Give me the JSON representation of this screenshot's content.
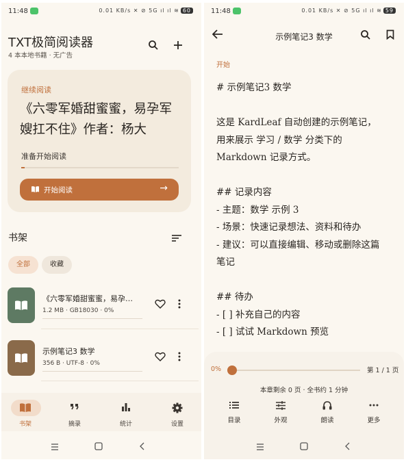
{
  "left": {
    "status": {
      "time": "11:48",
      "icons": "0.01 KB/s ✕ ⊘ 5G ıl ıl ≋",
      "battery": "60"
    },
    "header": {
      "title": "TXT极简阅读器",
      "subtitle": "4 本本地书籍 · 无广告"
    },
    "continue": {
      "label": "继续阅读",
      "title": "《六零军婚甜蜜蜜，易孕军嫂扛不住》作者：杨大",
      "status": "准备开始阅读",
      "progress": 0.02,
      "button": "开始阅读"
    },
    "shelf": {
      "title": "书架",
      "chips": [
        "全部",
        "收藏"
      ],
      "books": [
        {
          "title": "《六零军婚甜蜜蜜，易孕…",
          "meta": "1.2 MB · GB18030 · 0%",
          "cover_color": "#5e7a63"
        },
        {
          "title": "示例笔记3 数学",
          "meta": "356 B · UTF-8 · 0%",
          "cover_color": "#8a6a4a"
        }
      ]
    },
    "nav": [
      {
        "label": "书架",
        "icon": "book-open-icon",
        "active": true
      },
      {
        "label": "摘录",
        "icon": "quote-icon",
        "active": false
      },
      {
        "label": "统计",
        "icon": "bar-chart-icon",
        "active": false
      },
      {
        "label": "设置",
        "icon": "gear-icon",
        "active": false
      }
    ]
  },
  "right": {
    "status": {
      "time": "11:48",
      "icons": "0.01 KB/s ✕ ⊘ 5G ıl ıl ≋",
      "battery": "59"
    },
    "header": {
      "title": "示例笔记3 数学"
    },
    "chapter": "开始",
    "content": [
      "# 示例笔记3 数学",
      "",
      "这是 KardLeaf 自动创建的示例笔记，",
      "用来展示 学习 / 数学 分类下的",
      "Markdown 记录方式。",
      "",
      "## 记录内容",
      "- 主题：数学 示例 3",
      "- 场景：快速记录想法、资料和待办",
      "- 建议：可以直接编辑、移动或删除这篇",
      "笔记",
      "",
      "## 待办",
      "- [ ] 补充自己的内容",
      "- [ ] 试试 Markdown 预览"
    ],
    "reader": {
      "percent": "0%",
      "page": "第 1 / 1 页",
      "remain": "本章剩余 0 页 · 全书约 1 分钟",
      "tools": [
        {
          "label": "目录",
          "icon": "list-icon"
        },
        {
          "label": "外观",
          "icon": "sliders-icon"
        },
        {
          "label": "朗读",
          "icon": "headphones-icon"
        },
        {
          "label": "更多",
          "icon": "more-horizontal-icon"
        }
      ]
    }
  },
  "colors": {
    "accent": "#c0703c",
    "background": "#fbf7f0",
    "card": "#f3ebde"
  }
}
